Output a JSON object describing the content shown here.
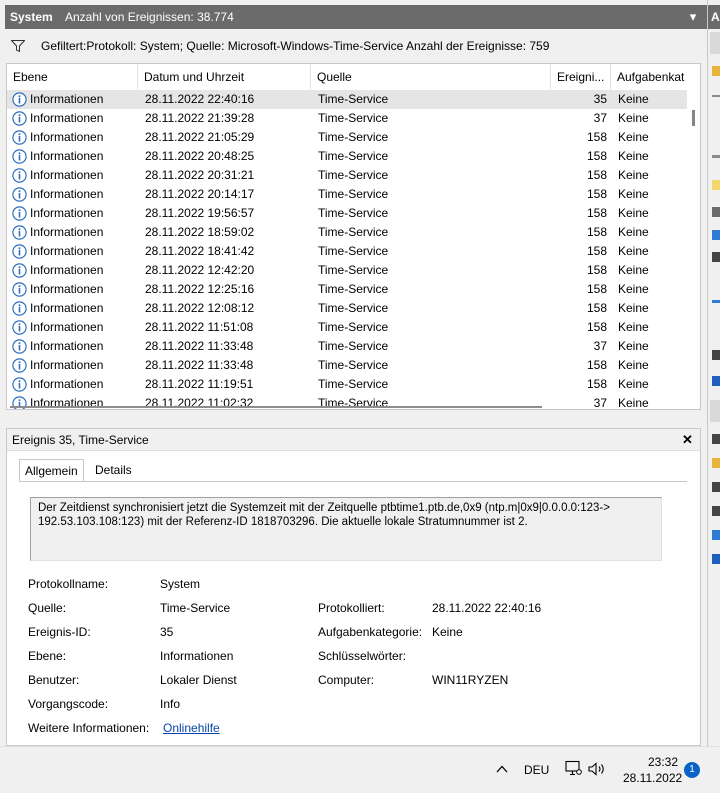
{
  "window": {
    "title": "System",
    "event_count": "Anzahl von Ereignissen: 38.774"
  },
  "filter": {
    "text": "Gefiltert:Protokoll: System; Quelle: Microsoft-Windows-Time-Service Anzahl der Ereignisse: 759"
  },
  "table": {
    "columns": [
      "Ebene",
      "Datum und Uhrzeit",
      "Quelle",
      "Ereigni...",
      "Aufgabenkat"
    ],
    "rows": [
      {
        "level": "Informationen",
        "datetime": "28.11.2022 22:40:16",
        "source": "Time-Service",
        "id": "35",
        "category": "Keine"
      },
      {
        "level": "Informationen",
        "datetime": "28.11.2022 21:39:28",
        "source": "Time-Service",
        "id": "37",
        "category": "Keine"
      },
      {
        "level": "Informationen",
        "datetime": "28.11.2022 21:05:29",
        "source": "Time-Service",
        "id": "158",
        "category": "Keine"
      },
      {
        "level": "Informationen",
        "datetime": "28.11.2022 20:48:25",
        "source": "Time-Service",
        "id": "158",
        "category": "Keine"
      },
      {
        "level": "Informationen",
        "datetime": "28.11.2022 20:31:21",
        "source": "Time-Service",
        "id": "158",
        "category": "Keine"
      },
      {
        "level": "Informationen",
        "datetime": "28.11.2022 20:14:17",
        "source": "Time-Service",
        "id": "158",
        "category": "Keine"
      },
      {
        "level": "Informationen",
        "datetime": "28.11.2022 19:56:57",
        "source": "Time-Service",
        "id": "158",
        "category": "Keine"
      },
      {
        "level": "Informationen",
        "datetime": "28.11.2022 18:59:02",
        "source": "Time-Service",
        "id": "158",
        "category": "Keine"
      },
      {
        "level": "Informationen",
        "datetime": "28.11.2022 18:41:42",
        "source": "Time-Service",
        "id": "158",
        "category": "Keine"
      },
      {
        "level": "Informationen",
        "datetime": "28.11.2022 12:42:20",
        "source": "Time-Service",
        "id": "158",
        "category": "Keine"
      },
      {
        "level": "Informationen",
        "datetime": "28.11.2022 12:25:16",
        "source": "Time-Service",
        "id": "158",
        "category": "Keine"
      },
      {
        "level": "Informationen",
        "datetime": "28.11.2022 12:08:12",
        "source": "Time-Service",
        "id": "158",
        "category": "Keine"
      },
      {
        "level": "Informationen",
        "datetime": "28.11.2022 11:51:08",
        "source": "Time-Service",
        "id": "158",
        "category": "Keine"
      },
      {
        "level": "Informationen",
        "datetime": "28.11.2022 11:33:48",
        "source": "Time-Service",
        "id": "37",
        "category": "Keine"
      },
      {
        "level": "Informationen",
        "datetime": "28.11.2022 11:33:48",
        "source": "Time-Service",
        "id": "158",
        "category": "Keine"
      },
      {
        "level": "Informationen",
        "datetime": "28.11.2022 11:19:51",
        "source": "Time-Service",
        "id": "158",
        "category": "Keine"
      },
      {
        "level": "Informationen",
        "datetime": "28.11.2022 11:02:32",
        "source": "Time-Service",
        "id": "37",
        "category": "Keine"
      }
    ]
  },
  "detail": {
    "title": "Ereignis 35, Time-Service",
    "tabs": [
      "Allgemein",
      "Details"
    ],
    "message_lines": [
      "Der Zeitdienst synchronisiert jetzt die Systemzeit mit der Zeitquelle ptbtime1.ptb.de,0x9 (ntp.m|0x9|0.0.0.0:123->",
      "192.53.103.108:123) mit der Referenz-ID 1818703296. Die aktuelle lokale Stratumnummer ist 2."
    ],
    "labels": {
      "protokollname": "Protokollname:",
      "quelle": "Quelle:",
      "ereignis_id": "Ereignis-ID:",
      "ebene": "Ebene:",
      "benutzer": "Benutzer:",
      "vorgangscode": "Vorgangscode:",
      "weitere": "Weitere Informationen:",
      "protokolliert": "Protokolliert:",
      "aufgabenkategorie": "Aufgabenkategorie:",
      "schluesselwoerter": "Schlüsselwörter:",
      "computer": "Computer:"
    },
    "values": {
      "protokollname": "System",
      "quelle": "Time-Service",
      "ereignis_id": "35",
      "ebene": "Informationen",
      "benutzer": "Lokaler Dienst",
      "vorgangscode": "Info",
      "weitere": "Onlinehilfe",
      "protokolliert": "28.11.2022 22:40:16",
      "aufgabenkategorie": "Keine",
      "schluesselwoerter": "",
      "computer": "WIN11RYZEN"
    }
  },
  "right_panel": {
    "header": "A"
  },
  "taskbar": {
    "language": "DEU",
    "time": "23:32",
    "date": "28.11.2022",
    "notifications": "1"
  }
}
